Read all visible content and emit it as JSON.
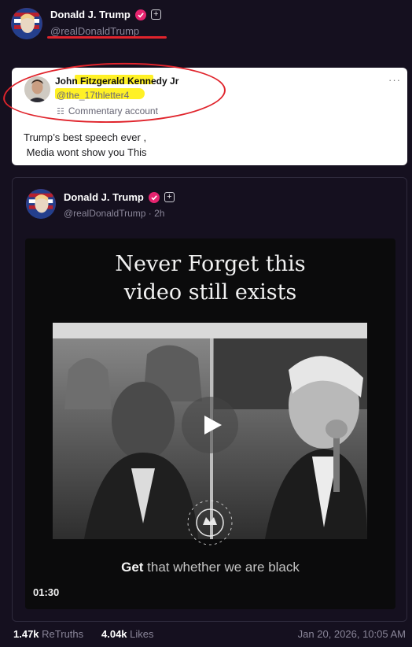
{
  "header": {
    "name": "Donald J. Trump",
    "handle": "@realDonaldTrump"
  },
  "quote": {
    "name": "John Fitzgerald Kennedy Jr",
    "handle": "@the_17thletter4",
    "badge": "Commentary account",
    "more": "···",
    "text": "Trump’s best speech ever ,\n Media wont show you This"
  },
  "post": {
    "name": "Donald J. Trump",
    "handle_time": "@realDonaldTrump · 2h",
    "video": {
      "title": "Never Forget this\nvideo still exists",
      "caption_bold": "Get",
      "caption_rest": " that whether we are black",
      "duration": "01:30"
    }
  },
  "footer": {
    "retruths_count": "1.47k",
    "retruths_label": " ReTruths",
    "likes_count": "4.04k",
    "likes_label": " Likes",
    "timestamp": "Jan 20, 2026, 10:05 AM"
  },
  "colors": {
    "background": "#15101f",
    "verified_badge": "#e6246f",
    "annotation_red": "#e0242c",
    "highlight_yellow": "#ffee00"
  },
  "icons": [
    "verified-icon",
    "plus-badge-icon",
    "commentary-icon",
    "more-options-icon",
    "play-icon"
  ]
}
